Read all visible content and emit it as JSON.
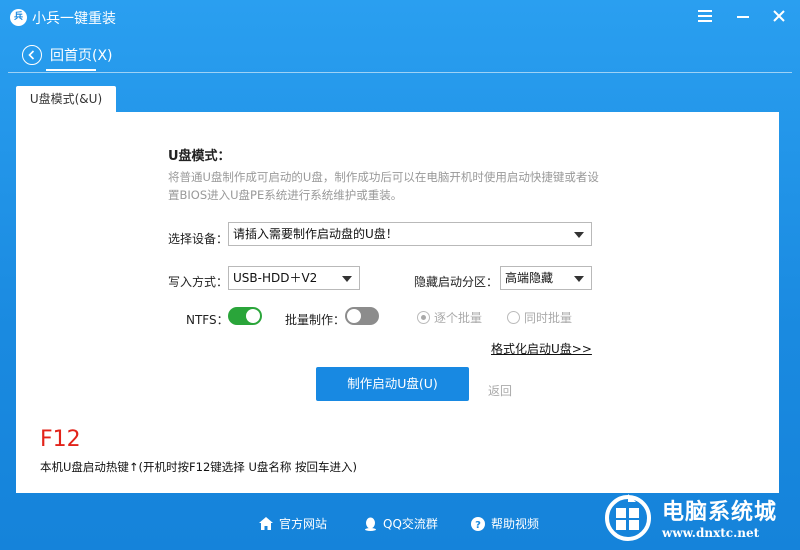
{
  "app": {
    "title": "小兵一键重装",
    "logo_text": "兵",
    "window_controls": {
      "menu": "menu-icon",
      "minimize": "minimize-icon",
      "close": "close-icon"
    }
  },
  "nav": {
    "back_label": "回首页(X)"
  },
  "tabs": [
    {
      "label": "U盘模式(&U)",
      "active": true
    }
  ],
  "content": {
    "section_title": "U盘模式：",
    "description": "将普通U盘制作成可启动的U盘，制作成功后可以在电脑开机时使用启动快捷键或者设置BIOS进入U盘PE系统进行系统维护或重装。",
    "device": {
      "label": "选择设备：",
      "value": "请插入需要制作启动盘的U盘！"
    },
    "write_mode": {
      "label": "写入方式：",
      "value": "USB-HDD＋V2"
    },
    "hidden_partition": {
      "label": "隐藏启动分区：",
      "value": "高端隐藏"
    },
    "ntfs": {
      "label": "NTFS：",
      "enabled": true
    },
    "batch": {
      "label": "批量制作：",
      "enabled": false
    },
    "radio_options": [
      {
        "label": "逐个批量",
        "checked": true
      },
      {
        "label": "同时批量",
        "checked": false
      }
    ],
    "format_link": "格式化启动U盘>>",
    "make_button": "制作启动U盘(U)",
    "back_link": "返回",
    "hotkey": "F12",
    "hotkey_desc": "本机U盘启动热键↑(开机时按F12键选择 U盘名称 按回车进入)"
  },
  "footer": {
    "links": [
      {
        "label": "官方网站",
        "icon": "home-icon"
      },
      {
        "label": "QQ交流群",
        "icon": "qq-icon"
      },
      {
        "label": "帮助视频",
        "icon": "help-icon"
      }
    ]
  },
  "watermark": {
    "title": "电脑系统城",
    "url": "www.dnxtc.net"
  },
  "colors": {
    "primary": "#1889e2",
    "hotkey": "#e2231a",
    "toggle_on": "#2aa53a",
    "toggle_off": "#8c8c8c"
  }
}
